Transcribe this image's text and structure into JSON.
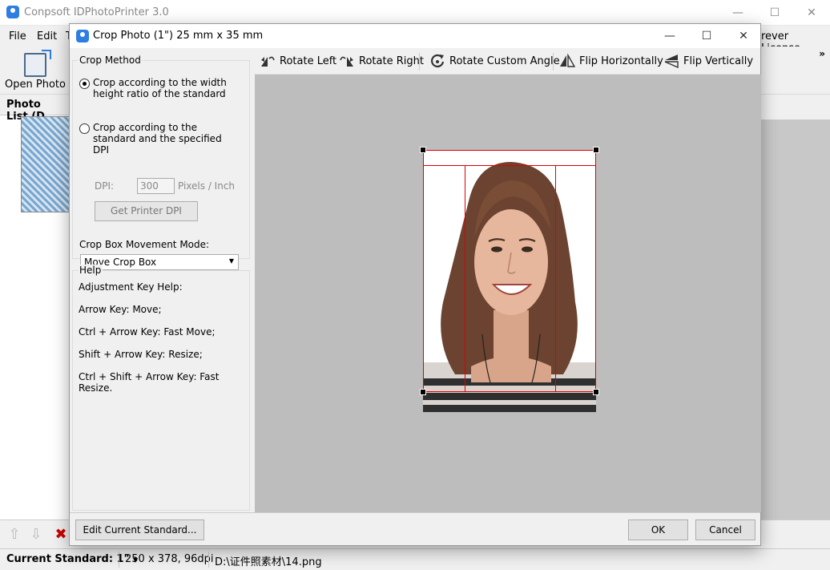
{
  "main_window": {
    "title": "Conpsoft IDPhotoPrinter 3.0",
    "menu": [
      "File",
      "Edit",
      "T"
    ],
    "license_text": "rever License",
    "toolbar": {
      "open_photo": "Open Photo",
      "more": "»"
    },
    "photo_list_title": "Photo List (D"
  },
  "window_controls": {
    "minimize": "—",
    "maximize": "☐",
    "close": "✕"
  },
  "dialog": {
    "title": "Crop Photo (1\") 25 mm x 35 mm",
    "crop_method": {
      "legend": "Crop Method",
      "option_ratio": "Crop according to the width height ratio of the standard",
      "option_dpi": "Crop according to the standard and the specified DPI",
      "selected": "ratio",
      "dpi_label": "DPI:",
      "dpi_value": "300",
      "dpi_unit": "Pixels / Inch",
      "printer_dpi_button": "Get Printer DPI",
      "movement_label": "Crop Box Movement Mode:",
      "movement_value": "Move Crop Box"
    },
    "help": {
      "legend": "Help",
      "lines": [
        "Adjustment Key Help:",
        "Arrow Key: Move;",
        "Ctrl + Arrow Key: Fast Move;",
        "Shift + Arrow Key: Resize;",
        "Ctrl + Shift + Arrow Key: Fast Resize."
      ]
    },
    "toolbar": {
      "rotate_left": "Rotate Left",
      "rotate_right": "Rotate Right",
      "rotate_custom": "Rotate Custom Angle",
      "flip_h": "Flip Horizontally",
      "flip_v": "Flip Vertically"
    },
    "footer": {
      "edit_standard": "Edit Current Standard...",
      "ok": "OK",
      "cancel": "Cancel"
    }
  },
  "status": {
    "standard": "Current Standard: 1\"",
    "size": "250 x 378, 96dpi",
    "path": "D:\\证件照素材\\14.png"
  },
  "colors": {
    "accent": "#2e7de0",
    "crop_line": "#e00000",
    "canvas": "#bdbdbd"
  }
}
